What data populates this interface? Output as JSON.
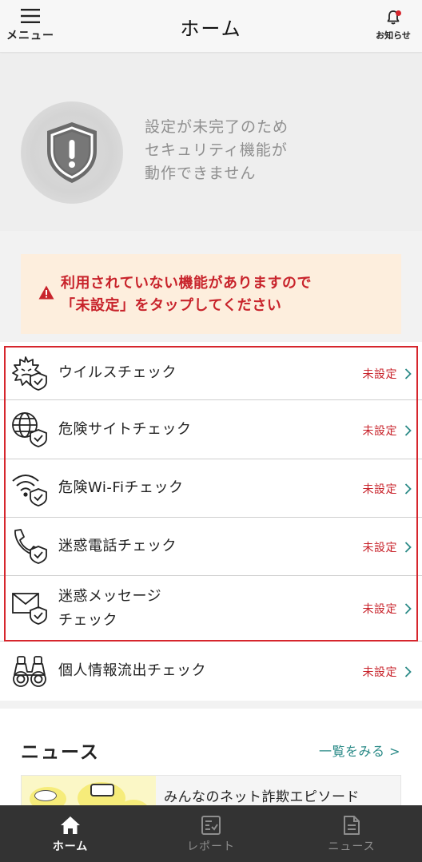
{
  "header": {
    "menu_label": "メニュー",
    "title": "ホーム",
    "notice_label": "お知らせ",
    "has_unread_notice": true
  },
  "status": {
    "icon": "shield-warning-icon",
    "lines": [
      "設定が未完了のため",
      "セキュリティ機能が",
      "動作できません"
    ]
  },
  "warning": {
    "icon": "warning-triangle-icon",
    "lines": [
      "利用されていない機能がありますので",
      "「未設定」をタップしてください"
    ]
  },
  "checks": [
    {
      "icon": "virus-shield-icon",
      "label": "ウイルスチェック",
      "status": "未設定"
    },
    {
      "icon": "globe-shield-icon",
      "label": "危険サイトチェック",
      "status": "未設定"
    },
    {
      "icon": "wifi-shield-icon",
      "label": "危険Wi-Fiチェック",
      "status": "未設定"
    },
    {
      "icon": "phone-shield-icon",
      "label": "迷惑電話チェック",
      "status": "未設定"
    },
    {
      "icon": "mail-shield-icon",
      "label_lines": [
        "迷惑メッセージ",
        "チェック"
      ],
      "status": "未設定"
    },
    {
      "icon": "binoculars-icon",
      "label": "個人情報流出チェック",
      "status": "未設定"
    }
  ],
  "news": {
    "title": "ニュース",
    "more_label": "一覧をみる >",
    "items": [
      {
        "title": "みんなのネット詐欺エピソード"
      }
    ]
  },
  "bottom_nav": [
    {
      "icon": "home-icon",
      "label": "ホーム",
      "active": true
    },
    {
      "icon": "report-icon",
      "label": "レポート",
      "active": false
    },
    {
      "icon": "news-icon",
      "label": "ニュース",
      "active": false
    }
  ],
  "colors": {
    "accent_red": "#c8232b",
    "link_teal": "#2a8a87",
    "warning_bg": "#fdeedd",
    "nav_bg": "#333333"
  }
}
